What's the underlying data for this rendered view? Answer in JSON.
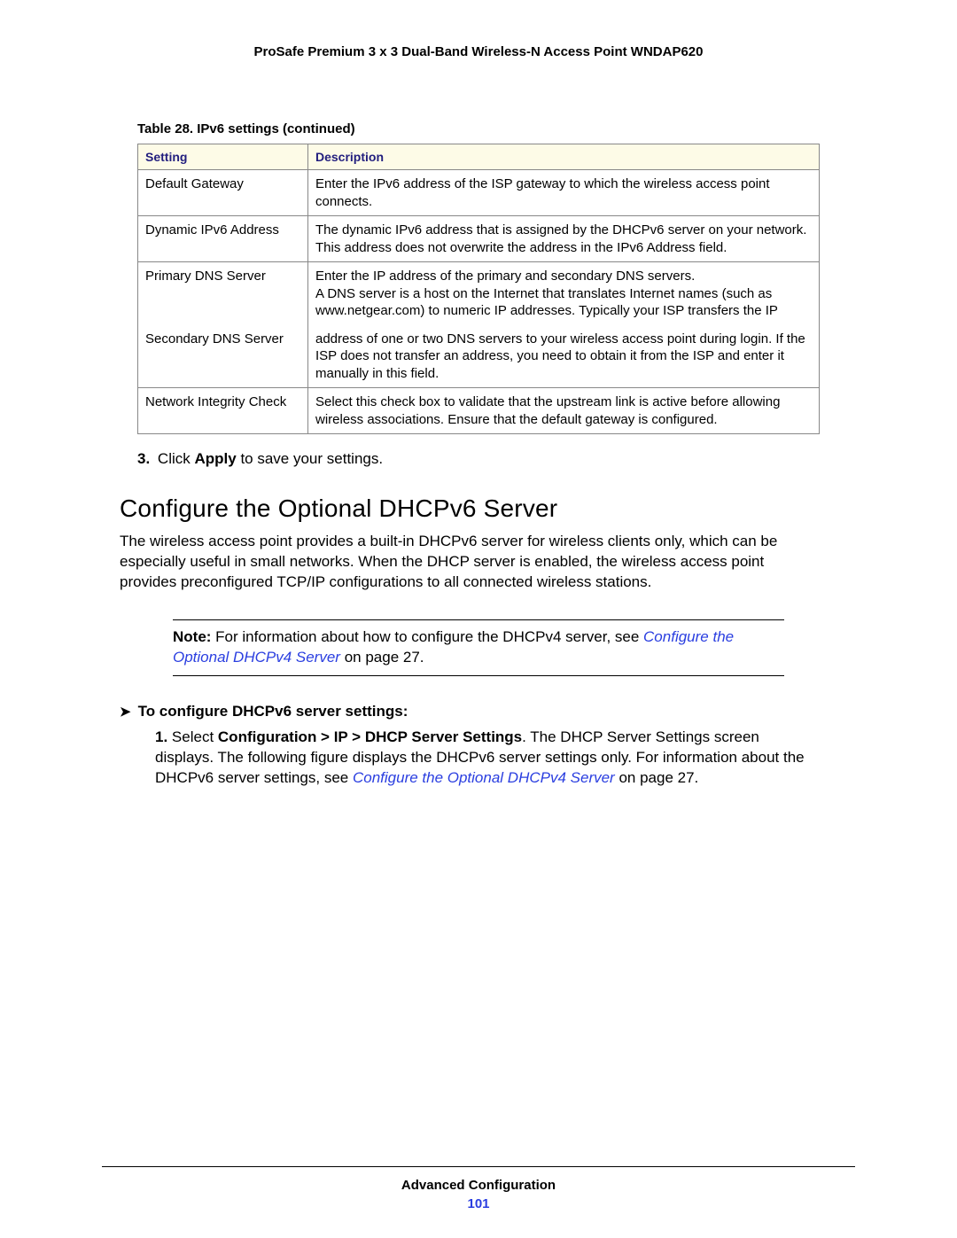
{
  "header": {
    "running": "ProSafe Premium 3 x 3 Dual-Band Wireless-N Access Point WNDAP620"
  },
  "table": {
    "caption": "Table 28.  IPv6 settings (continued)",
    "col1": "Setting",
    "col2": "Description",
    "rows": {
      "r1s": "Default Gateway",
      "r1d": "Enter the IPv6 address of the ISP gateway to which the wireless access point connects.",
      "r2s": "Dynamic IPv6 Address",
      "r2d": "The dynamic IPv6 address that is assigned by the DHCPv6 server on your network. This address does not overwrite the address in the IPv6 Address field.",
      "r3s": "Primary DNS Server",
      "r3d": "Enter the IP address of the primary and secondary DNS servers.\nA DNS server is a host on the Internet that translates Internet names (such as www.netgear.com) to numeric IP addresses. Typically your ISP transfers the IP",
      "r4s": "Secondary DNS Server",
      "r4d": "address of one or two DNS servers to your wireless access point during login. If the ISP does not transfer an address, you need to obtain it from the ISP and enter it manually in this field.",
      "r5s": "Network Integrity Check",
      "r5d": "Select this check box to validate that the upstream link is active before allowing wireless associations. Ensure that the default gateway is configured."
    }
  },
  "step3": {
    "num": "3.",
    "pre": "Click ",
    "bold": "Apply",
    "post": " to save your settings."
  },
  "section": {
    "title": "Configure the Optional DHCPv6 Server",
    "para": "The wireless access point provides a built-in DHCPv6 server for wireless clients only, which can be especially useful in small networks. When the DHCP server is enabled, the wireless access point provides preconfigured TCP/IP configurations to all connected wireless stations."
  },
  "note": {
    "label": "Note:",
    "text": " For information about how to configure the DHCPv4 server, see ",
    "xref": "Configure the Optional DHCPv4 Server",
    "tail": " on page 27."
  },
  "proc": {
    "arrow": "➤",
    "heading": "To configure DHCPv6 server settings:",
    "step1": {
      "num": "1.",
      "a": "Select ",
      "bold": "Configuration > IP > DHCP Server Settings",
      "b": ". The DHCP Server Settings screen displays. The following figure displays the DHCPv6 server settings only. For information about the DHCPv6 server settings, see ",
      "xref": "Configure the Optional DHCPv4 Server",
      "c": " on page 27."
    }
  },
  "footer": {
    "title": "Advanced Configuration",
    "page": "101"
  }
}
